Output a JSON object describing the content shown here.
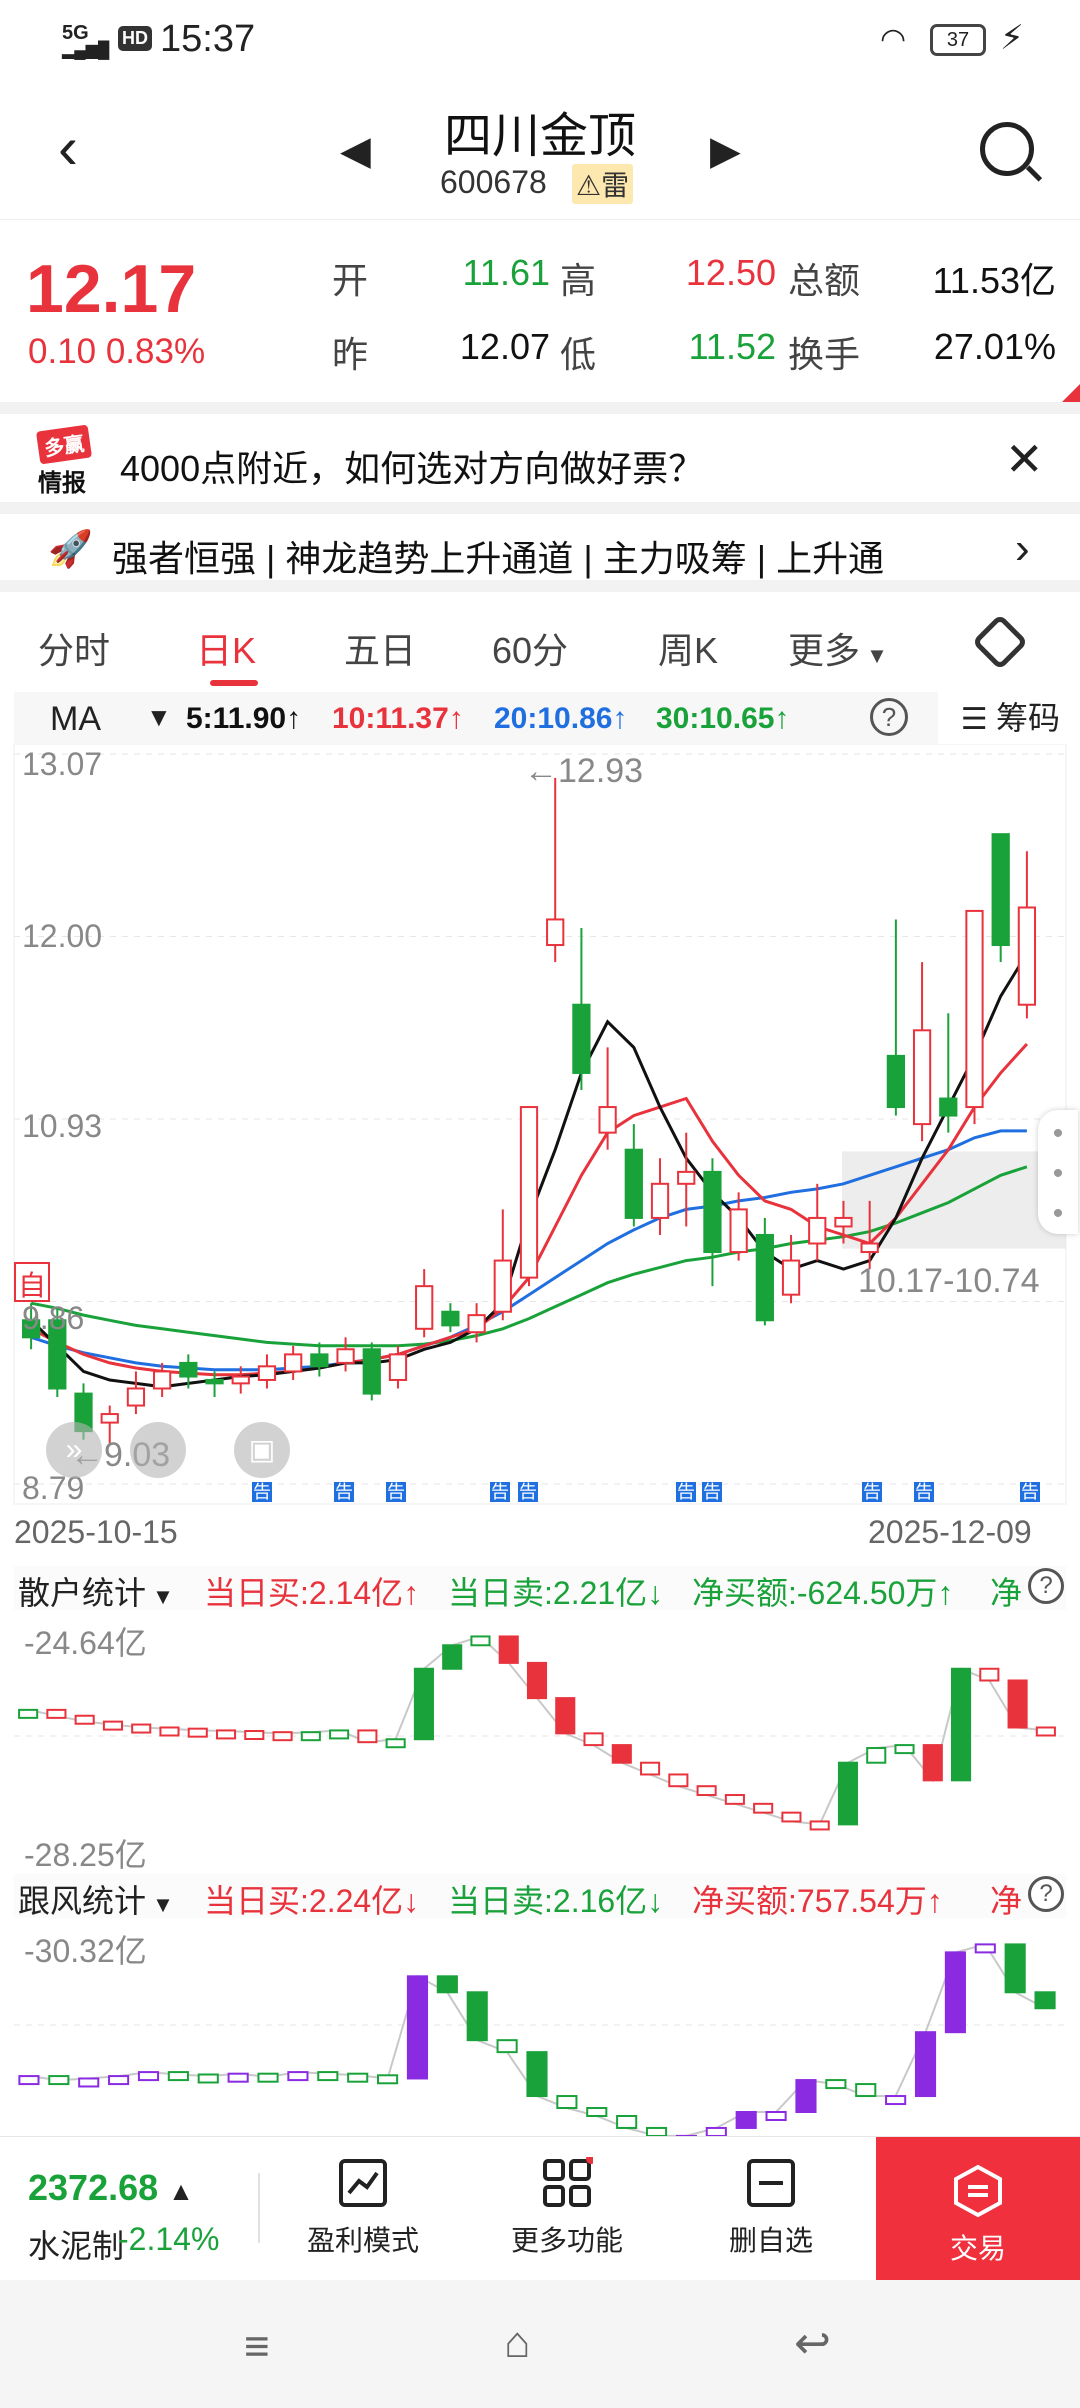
{
  "status_bar": {
    "network": "5G",
    "hd": "HD",
    "time": "15:37",
    "battery": "37"
  },
  "header": {
    "stock_name": "四川金顶",
    "stock_code": "600678",
    "warning_tag": "⚠雷"
  },
  "quote": {
    "price": "12.17",
    "change": "0.10 0.83%",
    "open_label": "开",
    "open": "11.61",
    "high_label": "高",
    "high": "12.50",
    "amount_label": "总额",
    "amount": "11.53亿",
    "prev_close_label": "昨",
    "prev_close": "12.07",
    "low_label": "低",
    "low": "11.52",
    "turnover_label": "换手",
    "turnover": "27.01%"
  },
  "ad": {
    "logo_top": "多赢",
    "logo_bottom": "情报",
    "text": "4000点附近，如何选对方向做好票？"
  },
  "news": {
    "text": "强者恒强 | 神龙趋势上升通道 | 主力吸筹 | 上升通"
  },
  "tabs": [
    {
      "label": "分时"
    },
    {
      "label": "日K"
    },
    {
      "label": "五日"
    },
    {
      "label": "60分"
    },
    {
      "label": "周K"
    },
    {
      "label": "更多"
    }
  ],
  "ma_bar": {
    "selector": "MA",
    "ma5": "5:11.90↑",
    "ma10": "10:11.37↑",
    "ma20": "20:10.86↑",
    "ma30": "30:10.65↑",
    "help": "?",
    "chips": "筹码"
  },
  "kchart": {
    "y_labels": [
      "13.07",
      "12.00",
      "10.93",
      "9.86",
      "8.79"
    ],
    "high_marker": "←12.93",
    "low_marker": "←9.03",
    "range_label": "10.17-10.74",
    "self_label": "自",
    "announce_label": "告",
    "start_date": "2025-10-15",
    "end_date": "2025-12-09"
  },
  "retail_panel": {
    "name": "散户统计",
    "buy": "当日买:2.14亿↑",
    "sell": "当日卖:2.21亿↓",
    "net": "净买额:-624.50万↑",
    "more": "净",
    "y_top": "-24.64亿",
    "y_bottom": "-28.25亿"
  },
  "follow_panel": {
    "name": "跟风统计",
    "buy": "当日买:2.24亿↓",
    "sell": "当日卖:2.16亿↓",
    "net": "净买额:757.54万↑",
    "more": "净",
    "y_top": "-30.32亿"
  },
  "bottom_bar": {
    "index_value": "2372.68",
    "index_arrow": "▲",
    "index_name": "水泥制",
    "index_change": "-2.14%",
    "buttons": [
      {
        "label": "盈利模式",
        "icon": "chart-trend-icon"
      },
      {
        "label": "更多功能",
        "icon": "grid-icon"
      },
      {
        "label": "删自选",
        "icon": "minus-square-icon"
      }
    ],
    "trade": "交易"
  },
  "colors": {
    "up": "#e8323c",
    "down": "#1aa23a",
    "ma5": "#111111",
    "ma10": "#e8323c",
    "ma20": "#1f6fe0",
    "ma30": "#1aa23a"
  },
  "chart_data": [
    {
      "type": "candlestick",
      "title": "",
      "x_range": [
        "2025-10-15",
        "2025-12-09"
      ],
      "ylim": [
        8.79,
        13.07
      ],
      "y_ticks": [
        13.07,
        12.0,
        10.93,
        9.86,
        8.79
      ],
      "candles": [
        {
          "o": 9.75,
          "c": 9.65,
          "h": 9.85,
          "l": 9.58
        },
        {
          "o": 9.75,
          "c": 9.35,
          "h": 9.82,
          "l": 9.3
        },
        {
          "o": 9.32,
          "c": 9.1,
          "h": 9.38,
          "l": 9.05
        },
        {
          "o": 9.15,
          "c": 9.2,
          "h": 9.25,
          "l": 9.03
        },
        {
          "o": 9.25,
          "c": 9.35,
          "h": 9.45,
          "l": 9.2
        },
        {
          "o": 9.35,
          "c": 9.45,
          "h": 9.5,
          "l": 9.3
        },
        {
          "o": 9.5,
          "c": 9.42,
          "h": 9.55,
          "l": 9.35
        },
        {
          "o": 9.4,
          "c": 9.38,
          "h": 9.45,
          "l": 9.3
        },
        {
          "o": 9.38,
          "c": 9.42,
          "h": 9.48,
          "l": 9.32
        },
        {
          "o": 9.4,
          "c": 9.48,
          "h": 9.55,
          "l": 9.35
        },
        {
          "o": 9.45,
          "c": 9.55,
          "h": 9.6,
          "l": 9.4
        },
        {
          "o": 9.55,
          "c": 9.48,
          "h": 9.62,
          "l": 9.42
        },
        {
          "o": 9.5,
          "c": 9.58,
          "h": 9.65,
          "l": 9.45
        },
        {
          "o": 9.58,
          "c": 9.32,
          "h": 9.62,
          "l": 9.28
        },
        {
          "o": 9.4,
          "c": 9.55,
          "h": 9.6,
          "l": 9.35
        },
        {
          "o": 9.7,
          "c": 9.95,
          "h": 10.05,
          "l": 9.65
        },
        {
          "o": 9.8,
          "c": 9.72,
          "h": 9.85,
          "l": 9.68
        },
        {
          "o": 9.68,
          "c": 9.78,
          "h": 9.85,
          "l": 9.62
        },
        {
          "o": 9.8,
          "c": 10.1,
          "h": 10.4,
          "l": 9.75
        },
        {
          "o": 10.0,
          "c": 11.0,
          "h": 11.0,
          "l": 9.95
        },
        {
          "o": 11.95,
          "c": 12.1,
          "h": 12.93,
          "l": 11.85
        },
        {
          "o": 11.6,
          "c": 11.2,
          "h": 12.05,
          "l": 11.1
        },
        {
          "o": 10.85,
          "c": 11.0,
          "h": 11.35,
          "l": 10.75
        },
        {
          "o": 10.75,
          "c": 10.35,
          "h": 10.9,
          "l": 10.3
        },
        {
          "o": 10.35,
          "c": 10.55,
          "h": 10.7,
          "l": 10.25
        },
        {
          "o": 10.55,
          "c": 10.62,
          "h": 10.85,
          "l": 10.3
        },
        {
          "o": 10.62,
          "c": 10.15,
          "h": 10.7,
          "l": 9.95
        },
        {
          "o": 10.15,
          "c": 10.4,
          "h": 10.5,
          "l": 10.1
        },
        {
          "o": 10.25,
          "c": 9.75,
          "h": 10.35,
          "l": 9.72
        },
        {
          "o": 9.9,
          "c": 10.1,
          "h": 10.25,
          "l": 9.85
        },
        {
          "o": 10.2,
          "c": 10.35,
          "h": 10.55,
          "l": 10.1
        },
        {
          "o": 10.3,
          "c": 10.35,
          "h": 10.45,
          "l": 10.2
        },
        {
          "o": 10.15,
          "c": 10.2,
          "h": 10.45,
          "l": 10.05
        },
        {
          "o": 11.3,
          "c": 11.0,
          "h": 12.1,
          "l": 10.95
        },
        {
          "o": 10.9,
          "c": 11.45,
          "h": 11.85,
          "l": 10.8
        },
        {
          "o": 11.05,
          "c": 10.95,
          "h": 11.55,
          "l": 10.85
        },
        {
          "o": 11.0,
          "c": 12.15,
          "h": 12.15,
          "l": 10.9
        },
        {
          "o": 12.6,
          "c": 11.95,
          "h": 12.6,
          "l": 11.85
        },
        {
          "o": 11.6,
          "c": 12.17,
          "h": 12.5,
          "l": 11.52
        }
      ],
      "ma5_line": [
        9.75,
        9.6,
        9.45,
        9.4,
        9.38,
        9.36,
        9.38,
        9.4,
        9.42,
        9.43,
        9.45,
        9.47,
        9.5,
        9.5,
        9.52,
        9.58,
        9.62,
        9.7,
        9.85,
        10.35,
        10.75,
        11.2,
        11.5,
        11.35,
        11.0,
        10.7,
        10.5,
        10.35,
        10.15,
        10.05,
        10.1,
        10.05,
        10.1,
        10.35,
        10.7,
        11.0,
        11.3,
        11.65,
        11.9
      ],
      "ma10_line": [
        9.7,
        9.62,
        9.55,
        9.5,
        9.47,
        9.45,
        9.44,
        9.43,
        9.43,
        9.44,
        9.45,
        9.47,
        9.5,
        9.52,
        9.55,
        9.6,
        9.65,
        9.7,
        9.82,
        10.0,
        10.3,
        10.6,
        10.85,
        10.95,
        11.0,
        11.05,
        10.8,
        10.6,
        10.45,
        10.4,
        10.3,
        10.25,
        10.2,
        10.35,
        10.55,
        10.75,
        11.0,
        11.2,
        11.37
      ],
      "ma20_line": [
        9.65,
        9.6,
        9.56,
        9.53,
        9.5,
        9.48,
        9.47,
        9.46,
        9.46,
        9.46,
        9.47,
        9.48,
        9.5,
        9.52,
        9.55,
        9.6,
        9.65,
        9.72,
        9.8,
        9.9,
        10.0,
        10.1,
        10.2,
        10.28,
        10.35,
        10.4,
        10.42,
        10.45,
        10.47,
        10.5,
        10.52,
        10.55,
        10.6,
        10.65,
        10.7,
        10.75,
        10.82,
        10.86,
        10.86
      ],
      "ma30_line": [
        9.85,
        9.82,
        9.78,
        9.75,
        9.72,
        9.7,
        9.68,
        9.66,
        9.64,
        9.62,
        9.61,
        9.6,
        9.6,
        9.6,
        9.6,
        9.61,
        9.63,
        9.66,
        9.7,
        9.76,
        9.83,
        9.9,
        9.97,
        10.02,
        10.06,
        10.1,
        10.12,
        10.15,
        10.17,
        10.2,
        10.22,
        10.24,
        10.27,
        10.32,
        10.38,
        10.44,
        10.52,
        10.6,
        10.65
      ]
    },
    {
      "type": "bar",
      "title": "散户统计",
      "ylim": [
        -28.25,
        -24.64
      ],
      "values": [
        -26.0,
        -26.1,
        -26.2,
        -26.25,
        -26.3,
        -26.32,
        -26.35,
        -26.36,
        -26.38,
        -26.4,
        -26.38,
        -26.35,
        -26.55,
        -26.5,
        -25.3,
        -24.9,
        -24.75,
        -25.2,
        -25.8,
        -26.4,
        -26.6,
        -26.9,
        -27.1,
        -27.3,
        -27.45,
        -27.6,
        -27.75,
        -27.9,
        -27.95,
        -26.9,
        -26.65,
        -26.6,
        -27.2,
        -25.3,
        -25.5,
        -26.3,
        -26.35
      ]
    },
    {
      "type": "bar",
      "title": "跟风统计",
      "ylim": [
        -32.5,
        -30.32
      ],
      "values": [
        -32.05,
        -32.1,
        -32.08,
        -32.05,
        -32.0,
        -32.03,
        -32.05,
        -32.02,
        -32.06,
        -32.0,
        -32.02,
        -32.04,
        -32.08,
        -30.8,
        -31.0,
        -31.6,
        -31.75,
        -32.3,
        -32.45,
        -32.55,
        -32.7,
        -32.8,
        -32.8,
        -32.7,
        -32.5,
        -32.5,
        -32.1,
        -32.15,
        -32.3,
        -32.3,
        -31.5,
        -30.5,
        -30.4,
        -31.0,
        -31.2
      ]
    }
  ]
}
